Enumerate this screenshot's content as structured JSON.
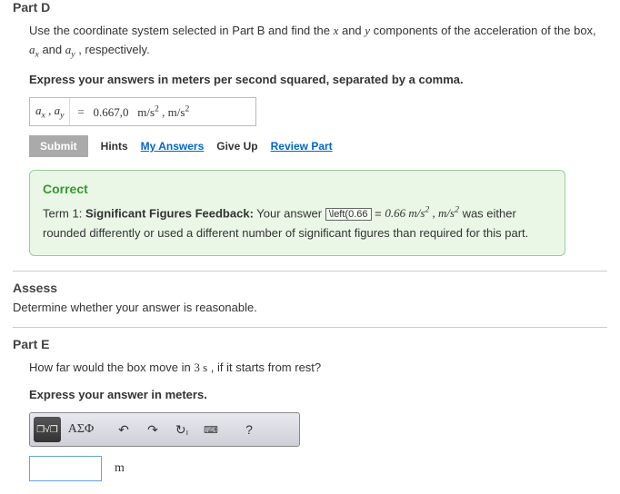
{
  "partD": {
    "header": "Part D",
    "question_pre": "Use the coordinate system selected in Part B and find the ",
    "question_mid1": " and ",
    "question_mid2": " components of the acceleration of the box, ",
    "question_mid3": " and ",
    "question_end": " , respectively.",
    "x_var": "x",
    "y_var": "y",
    "ax_html": "a<sub>x</sub>",
    "ay_html": "a<sub>y</sub>",
    "instruction": "Express your answers in meters per second squared, separated by a comma.",
    "answer_label_html": "a<sub>x</sub> , a<sub>y</sub>",
    "equals": "=",
    "answer_value_html": "0.667,0&nbsp;&nbsp;&nbsp;m/s<sup>2</sup> , m/s<sup>2</sup>",
    "submit": "Submit",
    "hints": "Hints",
    "my_answers": "My Answers",
    "give_up": "Give Up",
    "review_part": "Review Part"
  },
  "feedback": {
    "title": "Correct",
    "term_prefix": "Term 1: ",
    "sigfig_label": "Significant Figures Feedback:",
    "text1": " Your answer ",
    "boxed": "\\left(0.66",
    "equals": " = ",
    "value_html": "0.66 m/s<sup>2</sup> , m/s<sup>2</sup>",
    "text2": " was either rounded differently or used a different number of significant figures than required for this part."
  },
  "assess": {
    "header": "Assess",
    "text": "Determine whether your answer is reasonable."
  },
  "partE": {
    "header": "Part E",
    "question_pre": "How far would the box move in ",
    "time_html": "3 s",
    "question_post": " , if it starts from rest?",
    "instruction": "Express your answer in meters.",
    "unit": "m",
    "toolbar": {
      "templates": "❐√❐",
      "greek": "ΑΣΦ",
      "undo": "↶",
      "redo": "↷",
      "reset": "↻",
      "reset_sub": "ı",
      "keyboard": "⌨",
      "help": "?"
    }
  }
}
